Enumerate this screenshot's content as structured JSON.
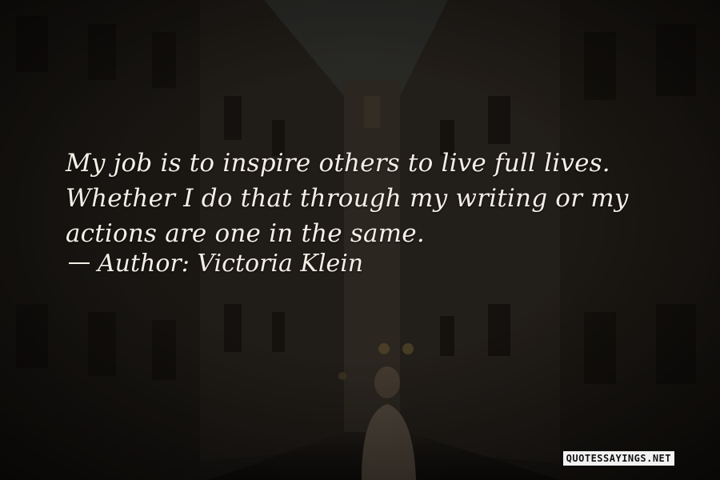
{
  "quote": {
    "text": "My job is to inspire others to live full lives. Whether I do that through my writing or my actions are one in the same.",
    "author_label": "Author:",
    "author_name": "Victoria Klein"
  },
  "watermark": {
    "text": "QUOTESSAYINGS.NET"
  },
  "colors": {
    "text": "#f4efe6",
    "background": "#1a1714",
    "watermark_bg": "#f2f2f2"
  },
  "background_image": {
    "subject": "dark narrow old-town alley with tall buildings and a person walking away"
  }
}
